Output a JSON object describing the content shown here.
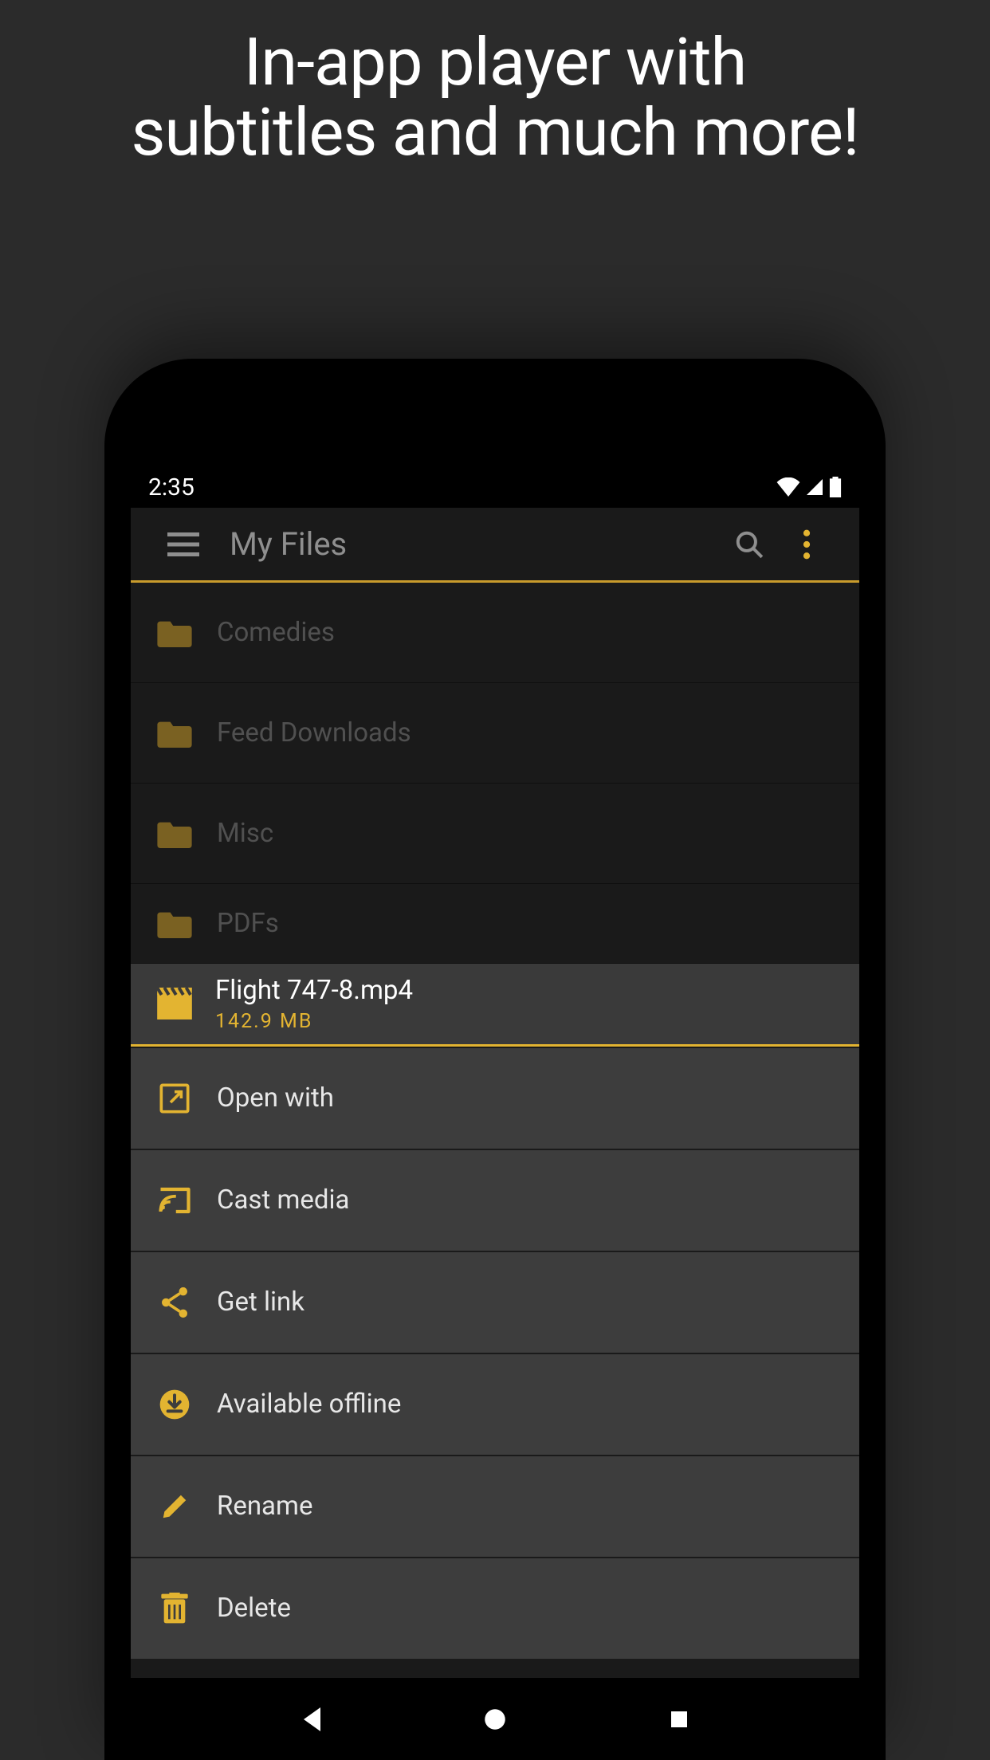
{
  "promo": {
    "line1": "In-app player with",
    "line2": "subtitles and much more!"
  },
  "statusbar": {
    "time": "2:35"
  },
  "toolbar": {
    "title": "My Files"
  },
  "colors": {
    "accent": "#e3b431",
    "folderIcon": "#8f7228"
  },
  "folders": [
    {
      "name": "Comedies"
    },
    {
      "name": "Feed Downloads"
    },
    {
      "name": "Misc"
    },
    {
      "name": "PDFs"
    }
  ],
  "selectedFile": {
    "name": "Flight 747-8.mp4",
    "size": "142.9 MB"
  },
  "contextMenu": [
    {
      "icon": "open-with-icon",
      "label": "Open with"
    },
    {
      "icon": "cast-icon",
      "label": "Cast media"
    },
    {
      "icon": "share-icon",
      "label": "Get link"
    },
    {
      "icon": "offline-icon",
      "label": "Available offline"
    },
    {
      "icon": "rename-icon",
      "label": "Rename"
    },
    {
      "icon": "delete-icon",
      "label": "Delete"
    }
  ]
}
